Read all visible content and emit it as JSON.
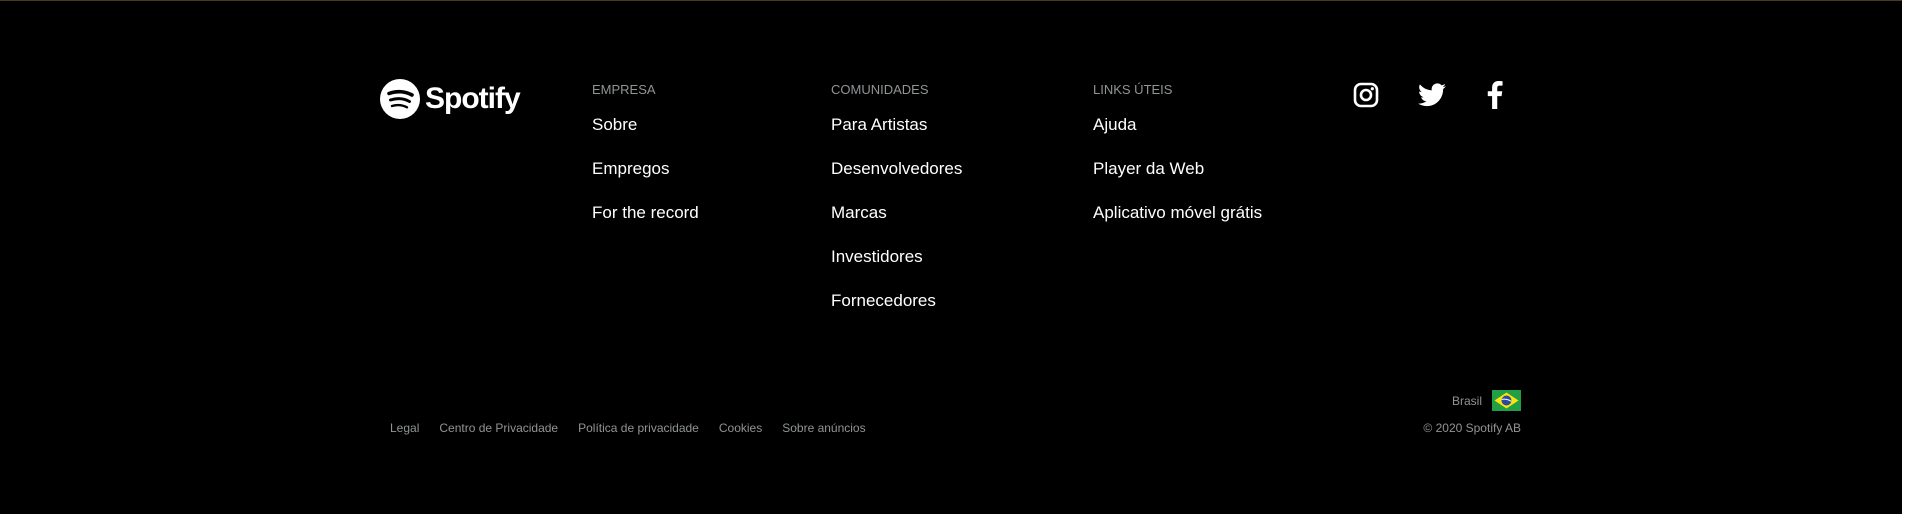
{
  "brand": {
    "name": "Spotify",
    "logo_icon": "spotify-logo-icon",
    "color": "#ffffff"
  },
  "columns": [
    {
      "title": "EMPRESA",
      "links": [
        "Sobre",
        "Empregos",
        "For the record"
      ]
    },
    {
      "title": "COMUNIDADES",
      "links": [
        "Para Artistas",
        "Desenvolvedores",
        "Marcas",
        "Investidores",
        "Fornecedores"
      ]
    },
    {
      "title": "LINKS ÚTEIS",
      "links": [
        "Ajuda",
        "Player da Web",
        "Aplicativo móvel grátis"
      ]
    }
  ],
  "social": [
    {
      "name": "instagram",
      "icon": "instagram-icon"
    },
    {
      "name": "twitter",
      "icon": "twitter-icon"
    },
    {
      "name": "facebook",
      "icon": "facebook-icon"
    }
  ],
  "bottom_links": [
    "Legal",
    "Centro de Privacidade",
    "Política de privacidade",
    "Cookies",
    "Sobre anúncios"
  ],
  "country": {
    "label": "Brasil",
    "flag_icon": "brazil-flag-icon"
  },
  "copyright": "© 2020 Spotify AB",
  "colors": {
    "background": "#000000",
    "muted_text": "#919496",
    "text": "#ffffff"
  }
}
